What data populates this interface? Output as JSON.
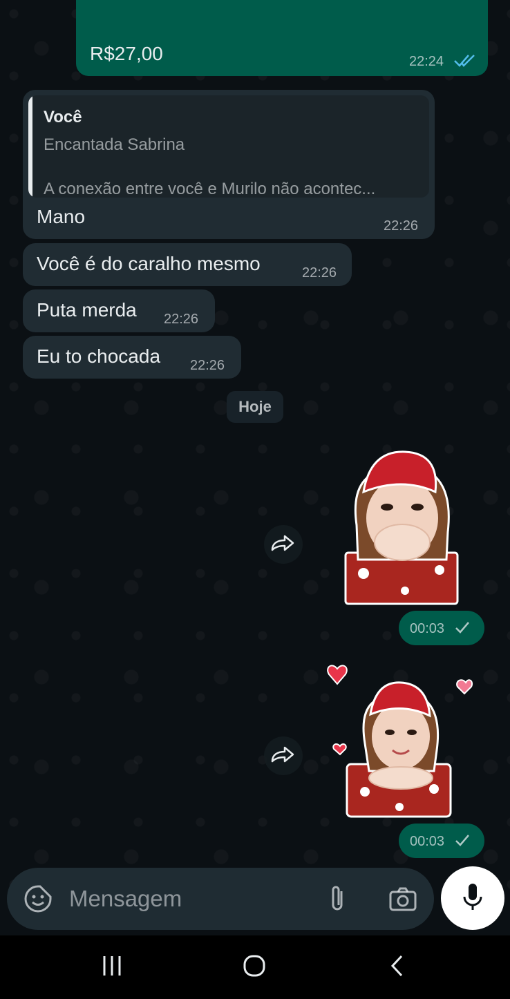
{
  "messages_prev": {
    "amount_bubble": {
      "text": "R$27,00",
      "time": "22:24",
      "status_icon": "double-check-read-icon"
    }
  },
  "reply": {
    "quote_author": "Você",
    "quote_line1": "Encantada Sabrina",
    "quote_line2": "A conexão entre você e Murilo não acontec...",
    "text": "Mano",
    "time": "22:26"
  },
  "incoming": [
    {
      "text": "Você é do caralho mesmo",
      "time": "22:26"
    },
    {
      "text": "Puta merda",
      "time": "22:26"
    },
    {
      "text": "Eu to chocada",
      "time": "22:26"
    }
  ],
  "date_divider": "Hoje",
  "stickers": [
    {
      "time": "00:03",
      "status_icon": "single-check-icon"
    },
    {
      "time": "00:03",
      "status_icon": "single-check-icon"
    }
  ],
  "composer": {
    "placeholder": "Mensagem",
    "icons": [
      "sticker-icon",
      "attach-icon",
      "camera-icon",
      "mic-icon"
    ]
  },
  "nav": {
    "icons": [
      "recent-apps-icon",
      "home-icon",
      "back-icon"
    ]
  },
  "colors": {
    "background": "#0b1014",
    "incoming_bubble": "#202c33",
    "outgoing_bubble": "#005c4b",
    "read_check": "#53bdeb"
  }
}
